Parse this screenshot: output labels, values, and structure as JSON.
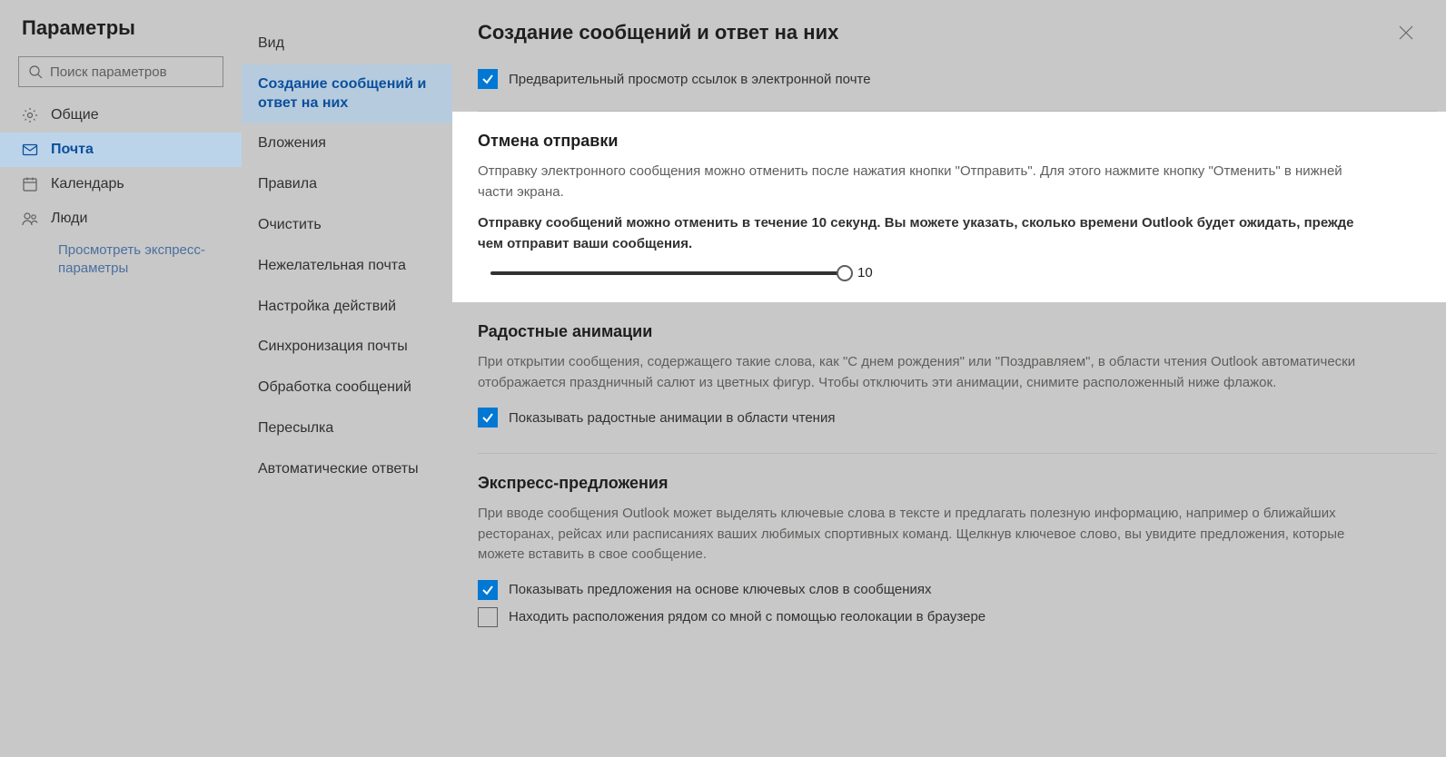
{
  "header": {
    "title": "Параметры",
    "search_placeholder": "Поиск параметров"
  },
  "nav": {
    "items": [
      {
        "label": "Общие",
        "icon": "gear"
      },
      {
        "label": "Почта",
        "icon": "mail",
        "active": true
      },
      {
        "label": "Календарь",
        "icon": "calendar"
      },
      {
        "label": "Люди",
        "icon": "people"
      }
    ],
    "quick_link": "Просмотреть экспресс-параметры"
  },
  "subnav": {
    "items": [
      "Вид",
      "Создание сообщений и ответ на них",
      "Вложения",
      "Правила",
      "Очистить",
      "Нежелательная почта",
      "Настройка действий",
      "Синхронизация почты",
      "Обработка сообщений",
      "Пересылка",
      "Автоматические ответы"
    ],
    "active_index": 1
  },
  "main": {
    "title": "Создание сообщений и ответ на них",
    "top_checkbox": {
      "label": "Предварительный просмотр ссылок в электронной почте",
      "checked": true
    },
    "undo": {
      "heading": "Отмена отправки",
      "desc": "Отправку электронного сообщения можно отменить после нажатия кнопки \"Отправить\". Для этого нажмите кнопку \"Отменить\" в нижней части экрана.",
      "bold_desc": "Отправку сообщений можно отменить в течение 10 секунд. Вы можете указать, сколько времени Outlook будет ожидать, прежде чем отправит ваши сообщения.",
      "value": "10"
    },
    "joyful": {
      "heading": "Радостные анимации",
      "desc": "При открытии сообщения, содержащего такие слова, как \"С днем рождения\" или \"Поздравляем\", в области чтения Outlook автоматически отображается праздничный салют из цветных фигур. Чтобы отключить эти анимации, снимите расположенный ниже флажок.",
      "checkbox": {
        "label": "Показывать радостные анимации в области чтения",
        "checked": true
      }
    },
    "suggest": {
      "heading": "Экспресс-предложения",
      "desc": "При вводе сообщения Outlook может выделять ключевые слова в тексте и предлагать полезную информацию, например о ближайших ресторанах, рейсах или расписаниях ваших любимых спортивных команд. Щелкнув ключевое слово, вы увидите предложения, которые можете вставить в свое сообщение.",
      "checkbox1": {
        "label": "Показывать предложения на основе ключевых слов в сообщениях",
        "checked": true
      },
      "checkbox2": {
        "label": "Находить расположения рядом со мной с помощью геолокации в браузере",
        "checked": false
      }
    }
  }
}
